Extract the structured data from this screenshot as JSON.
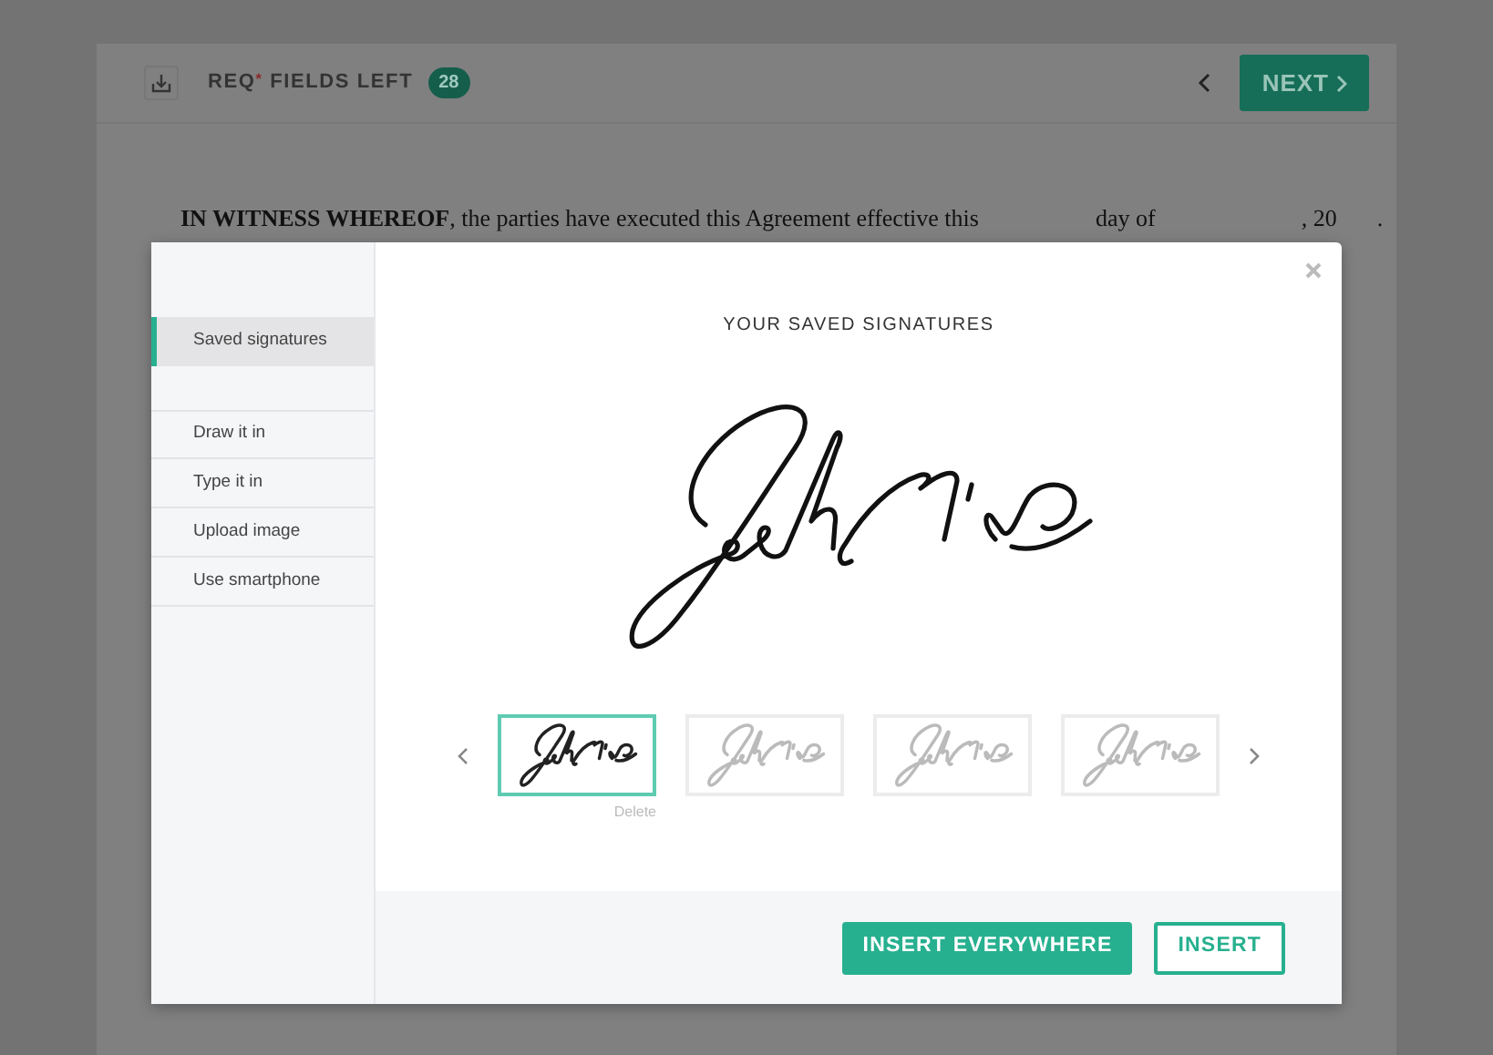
{
  "toolbar": {
    "fields_label": "REQ$^{*}$ FIELDS LEFT",
    "fields_count": "28",
    "next_button": "NEXT"
  },
  "document": {
    "parts": [
      "**IN WITNESS WHEREOF**, the parties have executed this Agreement effective this",
      "day of",
      ", 20",
      "."
    ]
  },
  "dialog": {
    "title": "YOUR SAVED SIGNATURES",
    "sidebar": {
      "items": [
        {
          "label": "Saved signatures",
          "selected": true
        },
        {
          "label": "Draw it in",
          "selected": false
        },
        {
          "label": "Type it in",
          "selected": false
        },
        {
          "label": "Upload image",
          "selected": false
        },
        {
          "label": "Use smartphone",
          "selected": false
        }
      ]
    },
    "thumbnails": [
      {
        "selected": true
      },
      {
        "selected": false
      },
      {
        "selected": false
      },
      {
        "selected": false
      }
    ],
    "delete_label": "Delete",
    "buttons": {
      "insert_everywhere": "INSERT EVERYWHERE",
      "insert": "INSERT"
    }
  }
}
